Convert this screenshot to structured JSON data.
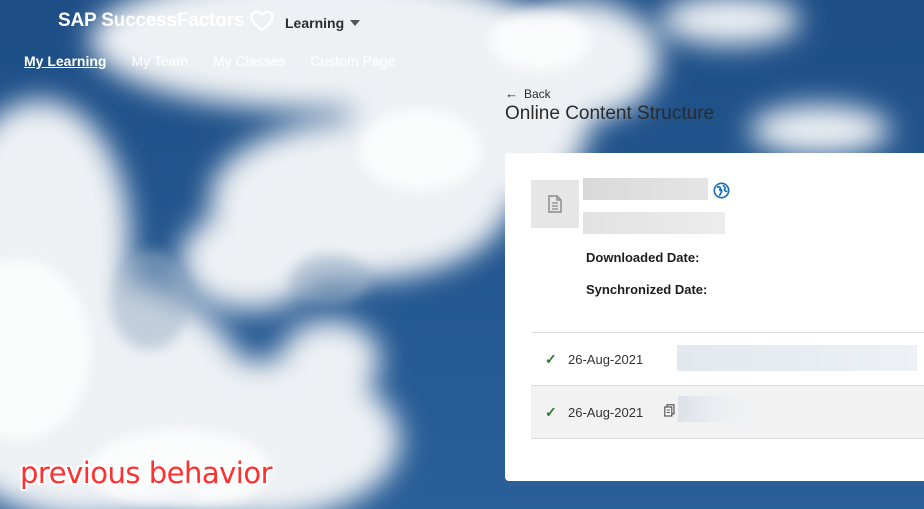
{
  "header": {
    "brand": "SAP SuccessFactors",
    "module": "Learning"
  },
  "nav": {
    "items": [
      {
        "label": "My Learning",
        "active": true
      },
      {
        "label": "My Team",
        "active": false
      },
      {
        "label": "My Classes",
        "active": false
      },
      {
        "label": "Custom Page",
        "active": false
      }
    ]
  },
  "page": {
    "back_label": "Back",
    "title": "Online Content Structure"
  },
  "content": {
    "downloaded_label": "Downloaded Date:",
    "synchronized_label": "Synchronized Date:",
    "rows": [
      {
        "status": "✓",
        "date": "26-Aug-2021"
      },
      {
        "status": "✓",
        "date": "26-Aug-2021"
      }
    ]
  },
  "annotation": "previous behavior",
  "colors": {
    "check": "#2b7d2b",
    "annotation": "#ff3030",
    "globe": "#1f6fb5"
  }
}
